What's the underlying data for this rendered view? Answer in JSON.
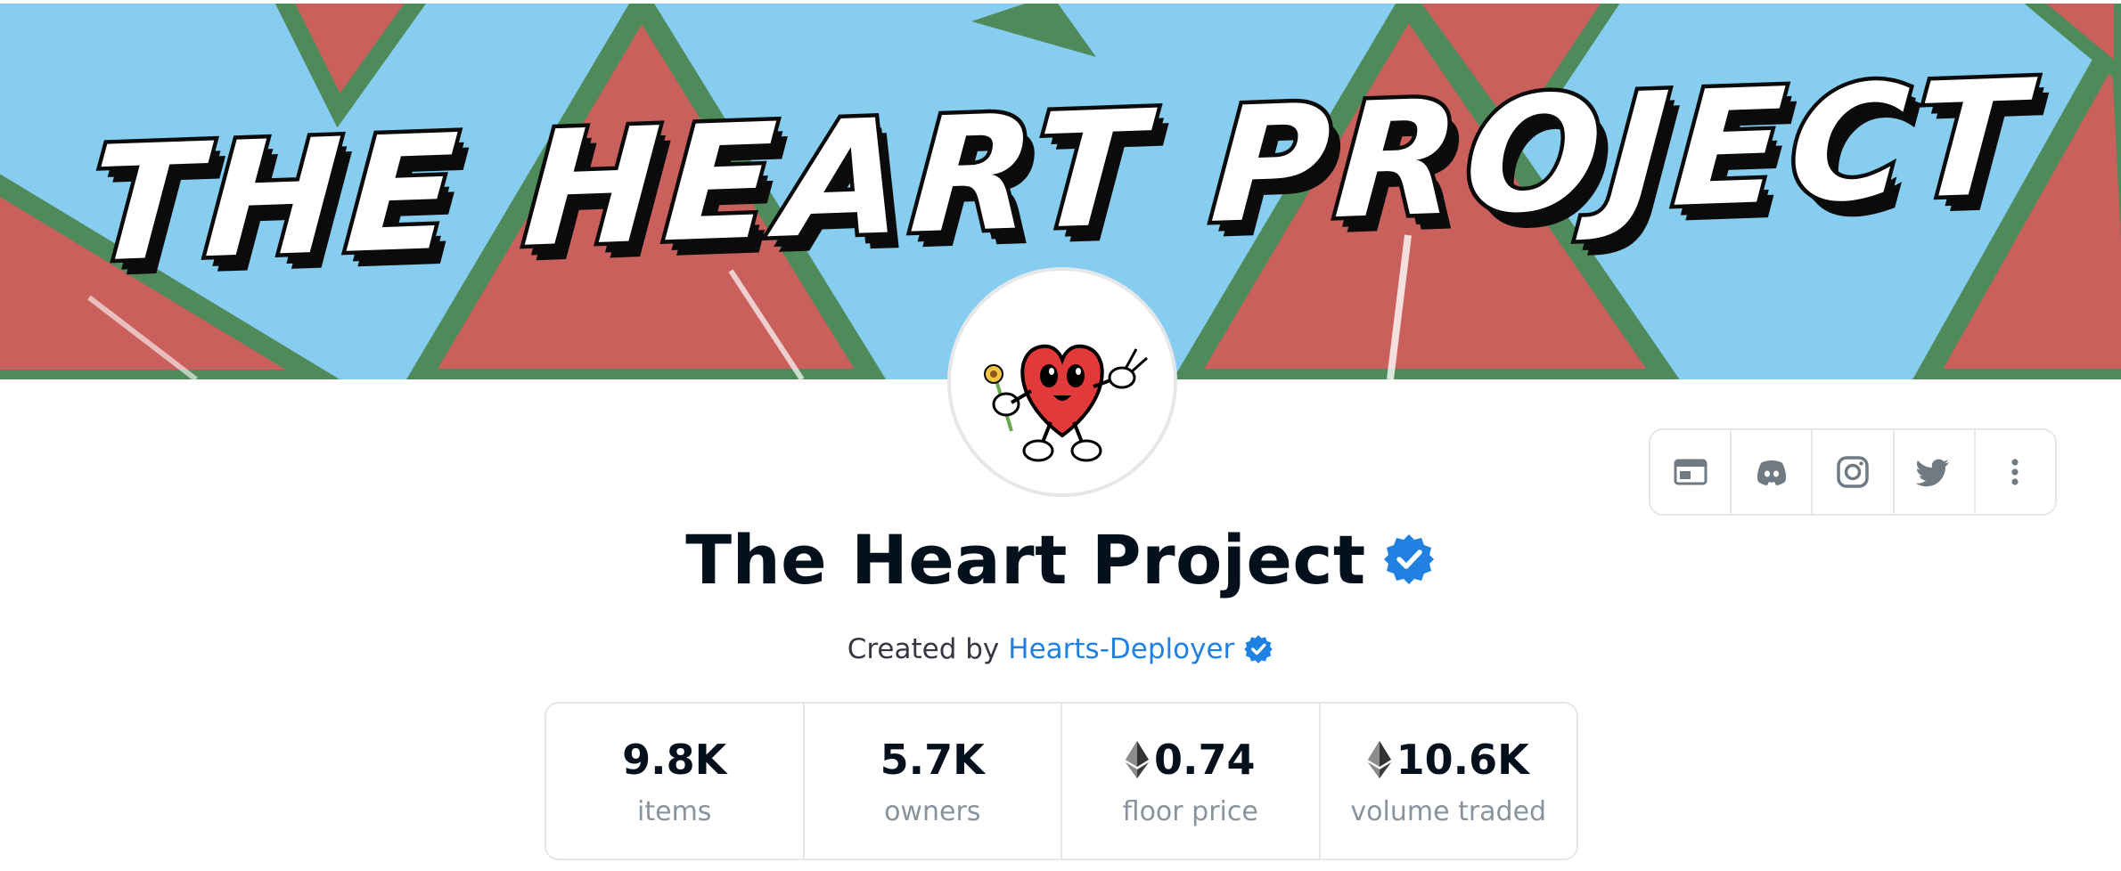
{
  "banner": {
    "text": "THE HEART PROJECT"
  },
  "collection": {
    "title": "The Heart Project",
    "verified": true
  },
  "creator": {
    "prefix": "Created by",
    "name": "Hearts-Deployer",
    "verified": true
  },
  "social": [
    {
      "icon": "website-icon",
      "label": "Website"
    },
    {
      "icon": "discord-icon",
      "label": "Discord"
    },
    {
      "icon": "instagram-icon",
      "label": "Instagram"
    },
    {
      "icon": "twitter-icon",
      "label": "Twitter"
    },
    {
      "icon": "more-options-icon",
      "label": "More"
    }
  ],
  "stats": [
    {
      "value": "9.8K",
      "label": "items",
      "eth": false
    },
    {
      "value": "5.7K",
      "label": "owners",
      "eth": false
    },
    {
      "value": "0.74",
      "label": "floor price",
      "eth": true
    },
    {
      "value": "10.6K",
      "label": "volume traded",
      "eth": true
    }
  ],
  "colors": {
    "accent": "#2081e2",
    "verified": "#2081e2",
    "text_primary": "#04111d",
    "text_secondary": "#8a939b",
    "border": "#e5e8eb",
    "banner_sky": "#86cdf0",
    "banner_red": "#c9605c",
    "banner_green": "#4f8a5b"
  }
}
